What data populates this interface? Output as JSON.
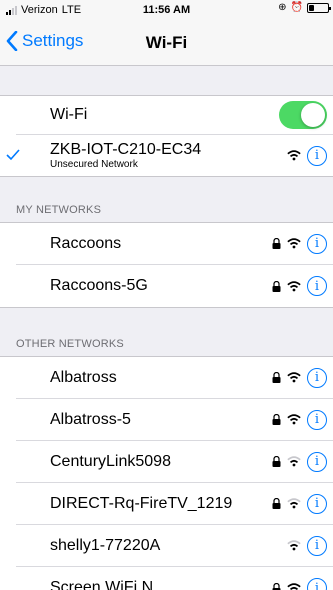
{
  "status": {
    "carrier": "Verizon",
    "network": "LTE",
    "time": "11:56 AM"
  },
  "nav": {
    "back_label": "Settings",
    "title": "Wi-Fi"
  },
  "wifi": {
    "label": "Wi-Fi",
    "enabled": true
  },
  "connected": {
    "name": "ZKB-IOT-C210-EC34",
    "subtitle": "Unsecured Network"
  },
  "my_networks": {
    "header": "MY NETWORKS",
    "items": [
      {
        "name": "Raccoons",
        "locked": true
      },
      {
        "name": "Raccoons-5G",
        "locked": true
      }
    ]
  },
  "other_networks": {
    "header": "OTHER NETWORKS",
    "items": [
      {
        "name": "Albatross",
        "locked": true
      },
      {
        "name": "Albatross-5",
        "locked": true
      },
      {
        "name": "CenturyLink5098",
        "locked": true
      },
      {
        "name": "DIRECT-Rq-FireTV_1219",
        "locked": true
      },
      {
        "name": "shelly1-77220A",
        "locked": false
      },
      {
        "name": "Screen WiFi N...",
        "locked": true
      }
    ]
  },
  "colors": {
    "accent": "#007aff",
    "toggle_on": "#4cd964",
    "background": "#efeff4"
  },
  "icons": {
    "wifi": "wifi-icon",
    "lock": "lock-icon",
    "info": "info-icon",
    "check": "checkmark-icon"
  }
}
